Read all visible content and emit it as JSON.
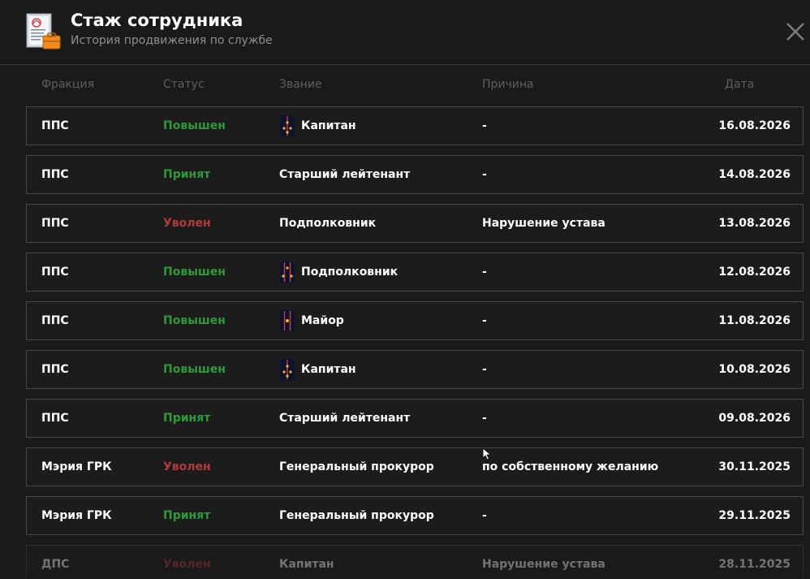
{
  "header": {
    "title": "Стаж сотрудника",
    "subtitle": "История продвижения по службе",
    "icon": "document-briefcase-icon"
  },
  "columns": {
    "fraction": "Фракция",
    "status": "Статус",
    "rank": "Звание",
    "reason": "Причина",
    "date": "Дата"
  },
  "colors": {
    "background": "#1a1a1a",
    "status_ok": "#2f9a3a",
    "status_bad": "#b23a3a",
    "row_border": "#474747"
  },
  "rows": [
    {
      "fraction": "ППС",
      "status": "Повышен",
      "status_type": "ok",
      "rank": "Капитан",
      "rank_icon": "captain",
      "reason": "-",
      "date": "16.08.2026"
    },
    {
      "fraction": "ППС",
      "status": "Принят",
      "status_type": "ok",
      "rank": "Старший лейтенант",
      "rank_icon": "",
      "reason": "-",
      "date": "14.08.2026"
    },
    {
      "fraction": "ППС",
      "status": "Уволен",
      "status_type": "bad",
      "rank": "Подполковник",
      "rank_icon": "",
      "reason": "Нарушение устава",
      "date": "13.08.2026"
    },
    {
      "fraction": "ППС",
      "status": "Повышен",
      "status_type": "ok",
      "rank": "Подполковник",
      "rank_icon": "lt-colonel",
      "reason": "-",
      "date": "12.08.2026"
    },
    {
      "fraction": "ППС",
      "status": "Повышен",
      "status_type": "ok",
      "rank": "Майор",
      "rank_icon": "major",
      "reason": "-",
      "date": "11.08.2026"
    },
    {
      "fraction": "ППС",
      "status": "Повышен",
      "status_type": "ok",
      "rank": "Капитан",
      "rank_icon": "captain",
      "reason": "-",
      "date": "10.08.2026"
    },
    {
      "fraction": "ППС",
      "status": "Принят",
      "status_type": "ok",
      "rank": "Старший лейтенант",
      "rank_icon": "",
      "reason": "-",
      "date": "09.08.2026"
    },
    {
      "fraction": "Мэрия ГРК",
      "status": "Уволен",
      "status_type": "bad",
      "rank": "Генеральный прокурор",
      "rank_icon": "",
      "reason": "по собственному желанию",
      "date": "30.11.2025"
    },
    {
      "fraction": "Мэрия ГРК",
      "status": "Принят",
      "status_type": "ok",
      "rank": "Генеральный прокурор",
      "rank_icon": "",
      "reason": "-",
      "date": "29.11.2025"
    },
    {
      "fraction": "ДПС",
      "status": "Уволен",
      "status_type": "bad",
      "rank": "Капитан",
      "rank_icon": "",
      "reason": "Нарушение устава",
      "date": "28.11.2025"
    }
  ]
}
